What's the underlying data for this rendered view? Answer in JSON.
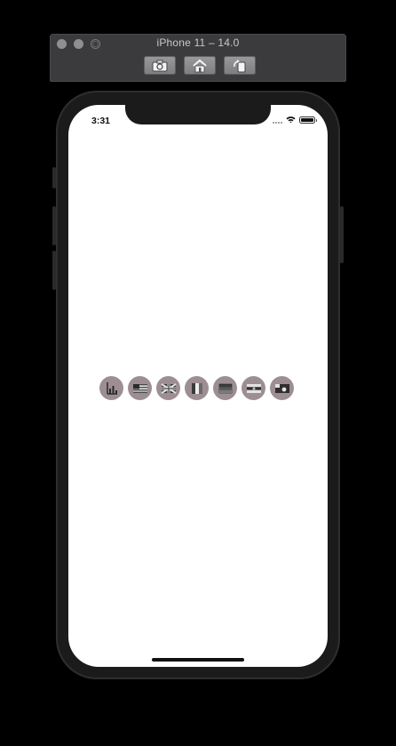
{
  "simulator": {
    "title": "iPhone 11 – 14.0",
    "toolbar": [
      {
        "name": "screenshot-button",
        "icon": "camera-icon"
      },
      {
        "name": "home-button",
        "icon": "home-icon"
      },
      {
        "name": "rotate-button",
        "icon": "rotate-icon"
      }
    ]
  },
  "status_bar": {
    "time": "3:31",
    "icons": [
      "cellular-signal-icon",
      "wifi-icon",
      "battery-icon"
    ]
  },
  "icon_row": {
    "background_color": "#9d8e93",
    "items": [
      {
        "icon": "bar-chart-icon"
      },
      {
        "icon": "flag-usa-icon"
      },
      {
        "icon": "flag-uk-icon"
      },
      {
        "icon": "flag-italy-icon"
      },
      {
        "icon": "flag-germany-icon"
      },
      {
        "icon": "flag-argentina-icon"
      },
      {
        "icon": "flag-japan-icon"
      }
    ]
  },
  "colors": {
    "screen_background": "#ffffff",
    "device_frame": "#1b1b1c",
    "window_chrome": "#3b3b3d"
  }
}
